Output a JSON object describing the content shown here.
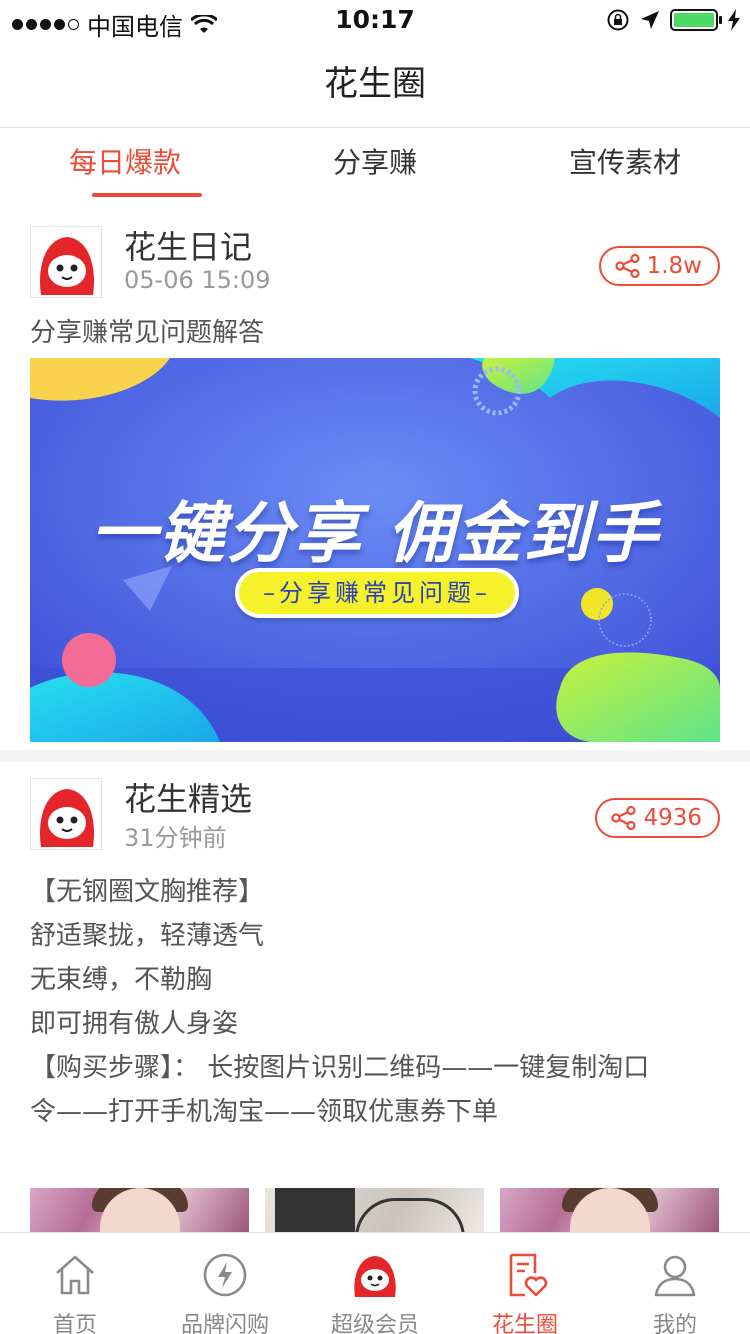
{
  "status_bar": {
    "carrier": "中国电信",
    "time": "10:17"
  },
  "nav": {
    "title": "花生圈"
  },
  "tabs": [
    {
      "label": "每日爆款",
      "active": true
    },
    {
      "label": "分享赚",
      "active": false
    },
    {
      "label": "宣传素材",
      "active": false
    }
  ],
  "posts": [
    {
      "author": "花生日记",
      "time": "05-06 15:09",
      "share_count": "1.8w",
      "text": "分享赚常见问题解答",
      "banner": {
        "headline": "一键分享 佣金到手",
        "pill": "–分享赚常见问题–"
      }
    },
    {
      "author": "花生精选",
      "time": "31分钟前",
      "share_count": "4936",
      "lines": [
        "【无钢圈文胸推荐】",
        "舒适聚拢，轻薄透气",
        "无束缚，不勒胸",
        "即可拥有傲人身姿",
        "【购买步骤】： 长按图片识别二维码——一键复制淘口",
        "令——打开手机淘宝——领取优惠券下单"
      ]
    }
  ],
  "tabbar": [
    {
      "label": "首页",
      "icon": "home-icon",
      "active": false
    },
    {
      "label": "品牌闪购",
      "icon": "flash-icon",
      "active": false
    },
    {
      "label": "超级会员",
      "icon": "mascot-icon",
      "active": false
    },
    {
      "label": "花生圈",
      "icon": "heart-note-icon",
      "active": true
    },
    {
      "label": "我的",
      "icon": "user-icon",
      "active": false
    }
  ],
  "colors": {
    "accent": "#ee4b37",
    "banner_blue": "#4a64e8",
    "battery_green": "#4cd964"
  }
}
